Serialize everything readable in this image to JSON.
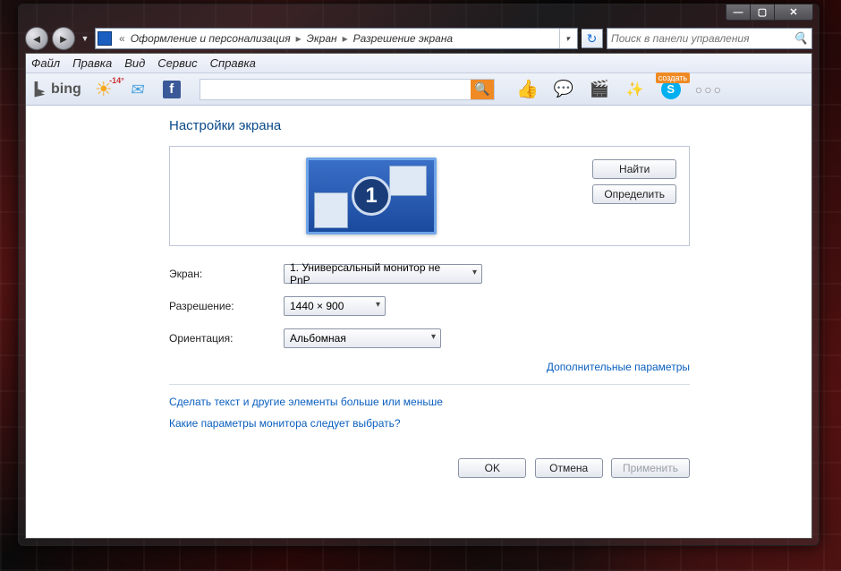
{
  "window_controls": {
    "min": "—",
    "max": "▢",
    "close": "✕"
  },
  "breadcrumb": {
    "item1": "Оформление и персонализация",
    "item2": "Экран",
    "item3": "Разрешение экрана"
  },
  "search_placeholder": "Поиск в панели управления",
  "menubar": {
    "file": "Файл",
    "edit": "Правка",
    "view": "Вид",
    "service": "Сервис",
    "help": "Справка"
  },
  "toolbar": {
    "bing": "bing",
    "temp": "-14°",
    "skype_badge": "создать"
  },
  "page": {
    "title": "Настройки экрана",
    "monitor_number": "1",
    "find_btn": "Найти",
    "detect_btn": "Определить",
    "screen_label": "Экран:",
    "screen_value": "1. Универсальный монитор не PnP",
    "resolution_label": "Разрешение:",
    "resolution_value": "1440 × 900",
    "orientation_label": "Ориентация:",
    "orientation_value": "Альбомная",
    "advanced_link": "Дополнительные параметры",
    "text_size_link": "Сделать текст и другие элементы больше или меньше",
    "which_settings_link": "Какие параметры монитора следует выбрать?",
    "ok": "OK",
    "cancel": "Отмена",
    "apply": "Применить"
  }
}
